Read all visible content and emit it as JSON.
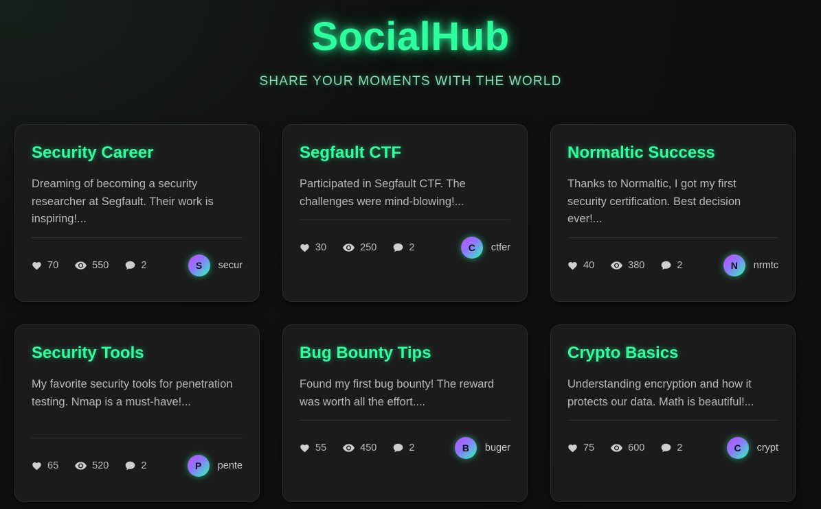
{
  "header": {
    "brand": "SocialHub",
    "tagline": "SHARE YOUR MOMENTS WITH THE WORLD"
  },
  "colors": {
    "accent": "#2dff9e",
    "card_bg": "#1b1b1b",
    "page_bg": "#0f0f0f"
  },
  "posts": [
    {
      "title": "Security Career",
      "text": "Dreaming of becoming a security researcher at Segfault. Their work is inspiring!...",
      "likes": "70",
      "views": "550",
      "comments": "2",
      "avatar": "S",
      "author": "secur"
    },
    {
      "title": "Segfault CTF",
      "text": "Participated in Segfault CTF. The challenges were mind-blowing!...",
      "likes": "30",
      "views": "250",
      "comments": "2",
      "avatar": "C",
      "author": "ctfer"
    },
    {
      "title": "Normaltic Success",
      "text": "Thanks to Normaltic, I got my first security certification. Best decision ever!...",
      "likes": "40",
      "views": "380",
      "comments": "2",
      "avatar": "N",
      "author": "nrmtc"
    },
    {
      "title": "Security Tools",
      "text": "My favorite security tools for penetration testing. Nmap is a must-have!...",
      "likes": "65",
      "views": "520",
      "comments": "2",
      "avatar": "P",
      "author": "pente"
    },
    {
      "title": "Bug Bounty Tips",
      "text": "Found my first bug bounty! The reward was worth all the effort....",
      "likes": "55",
      "views": "450",
      "comments": "2",
      "avatar": "B",
      "author": "buger"
    },
    {
      "title": "Crypto Basics",
      "text": "Understanding encryption and how it protects our data. Math is beautiful!...",
      "likes": "75",
      "views": "600",
      "comments": "2",
      "avatar": "C",
      "author": "crypt"
    }
  ],
  "icons": {
    "likes": "heart-icon",
    "views": "eye-icon",
    "comments": "comment-icon"
  }
}
